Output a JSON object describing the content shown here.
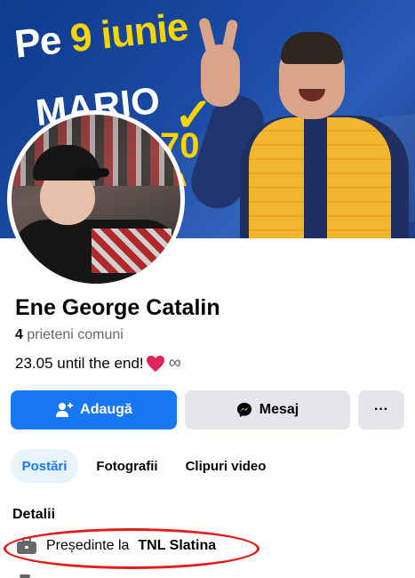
{
  "cover": {
    "headline_prefix": "Pe",
    "headline_date": "9 iunie",
    "name_partial": "MARIO",
    "number_partial": "70",
    "letter_partial": "A",
    "check": "✓"
  },
  "profile": {
    "name": "Ene George Catalin",
    "mutual_count": "4",
    "mutual_label": "prieteni comuni",
    "bio_text": "23.05 until the end!",
    "bio_infinity": "∞"
  },
  "actions": {
    "add_label": "Adaugă",
    "message_label": "Mesaj",
    "more_label": "···"
  },
  "tabs": [
    {
      "label": "Postări",
      "active": true
    },
    {
      "label": "Fotografii",
      "active": false
    },
    {
      "label": "Clipuri video",
      "active": false
    }
  ],
  "details": {
    "title": "Detalii",
    "work_prefix": "Președinte la",
    "work_place": "TNL Slatina"
  },
  "colors": {
    "primary": "#1877f2",
    "secondary_bg": "#e4e6eb",
    "highlight": "#e41c1c",
    "tab_active_bg": "#e7f3ff"
  },
  "icons": {
    "add_friend": "person-plus-icon",
    "messenger": "messenger-icon",
    "heart": "heart-icon",
    "work": "briefcase-icon"
  }
}
